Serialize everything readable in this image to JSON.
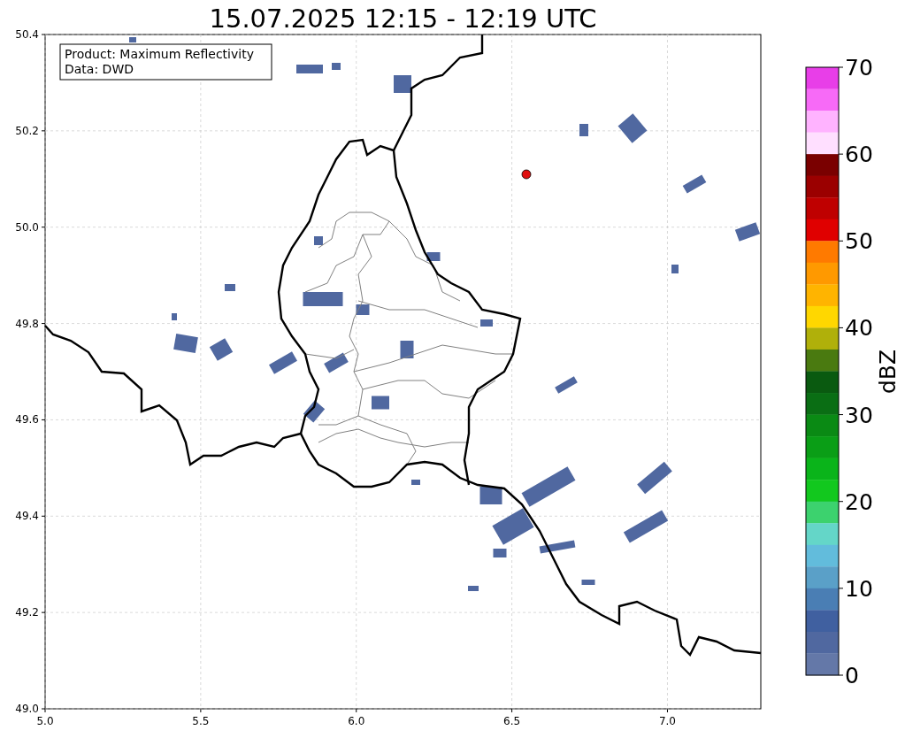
{
  "title": "15.07.2025 12:15 - 12:19 UTC",
  "info_box": [
    "Product: Maximum Reflectivity",
    "Data: DWD"
  ],
  "map": {
    "yticks": [
      "50.4",
      "50.2",
      "50.0",
      "49.8",
      "49.6",
      "49.4",
      "49.2",
      "49.0"
    ],
    "xticks": [
      "5.0",
      "5.5",
      "6.0",
      "6.5",
      "7.0"
    ]
  },
  "colorbar": {
    "ticks": [
      "70",
      "60",
      "50",
      "40",
      "30",
      "20",
      "10",
      "0"
    ],
    "label": "dBZ",
    "segments": [
      {
        "color": "#e83ee8"
      },
      {
        "color": "#f76af7"
      },
      {
        "color": "#ffb3ff"
      },
      {
        "color": "#ffdfff"
      },
      {
        "color": "#7a0000"
      },
      {
        "color": "#9b0000"
      },
      {
        "color": "#bf0000"
      },
      {
        "color": "#e00000"
      },
      {
        "color": "#ff7a00"
      },
      {
        "color": "#ff9900"
      },
      {
        "color": "#ffb400"
      },
      {
        "color": "#ffd700"
      },
      {
        "color": "#b0b00a"
      },
      {
        "color": "#4a7a10"
      },
      {
        "color": "#0a5a10"
      },
      {
        "color": "#0a6e14"
      },
      {
        "color": "#0a8a14"
      },
      {
        "color": "#0a9e16"
      },
      {
        "color": "#0ab41a"
      },
      {
        "color": "#12c81e"
      },
      {
        "color": "#3cd26e"
      },
      {
        "color": "#64d6c8"
      },
      {
        "color": "#62bcdc"
      },
      {
        "color": "#5aa0c8"
      },
      {
        "color": "#4a7eb4"
      },
      {
        "color": "#4060a0"
      },
      {
        "color": "#5068a0"
      },
      {
        "color": "#6478a8"
      }
    ]
  }
}
